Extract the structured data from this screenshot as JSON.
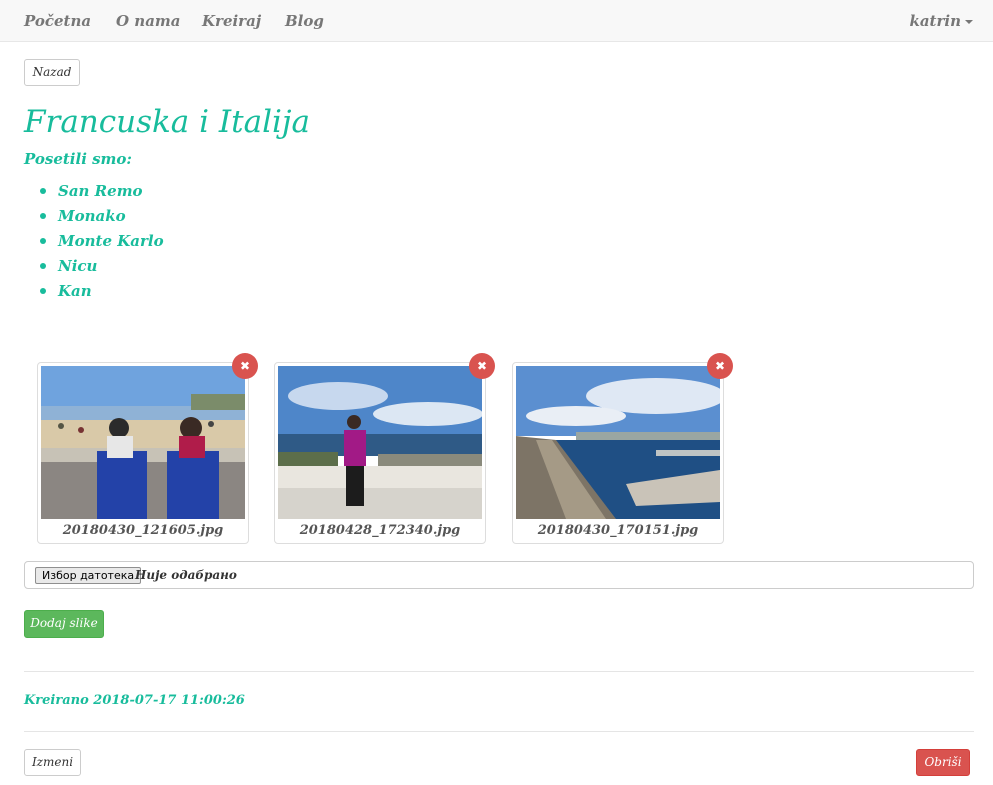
{
  "navbar": {
    "links": [
      "Početna",
      "O nama",
      "Kreiraj",
      "Blog"
    ],
    "user": "katrin"
  },
  "back_button": "Nazad",
  "post": {
    "title": "Francuska i Italija",
    "subtitle": "Posetili smo:",
    "places": [
      "San Remo",
      "Monako",
      "Monte Karlo",
      "Nicu",
      "Kan"
    ]
  },
  "images": [
    {
      "filename": "20180430_121605.jpg"
    },
    {
      "filename": "20180428_172340.jpg"
    },
    {
      "filename": "20180430_170151.jpg"
    }
  ],
  "remove_icon": "✖",
  "file_input": {
    "button_label": "Избор датотека",
    "status": "Није одабрано"
  },
  "add_images_button": "Dodaj slike",
  "created": "Kreirano 2018-07-17 11:00:26",
  "edit_button": "Izmeni",
  "delete_button": "Obriši",
  "colors": {
    "accent": "#18bc9c",
    "success": "#5cb85c",
    "danger": "#d9534f",
    "nav_text": "#777777"
  }
}
